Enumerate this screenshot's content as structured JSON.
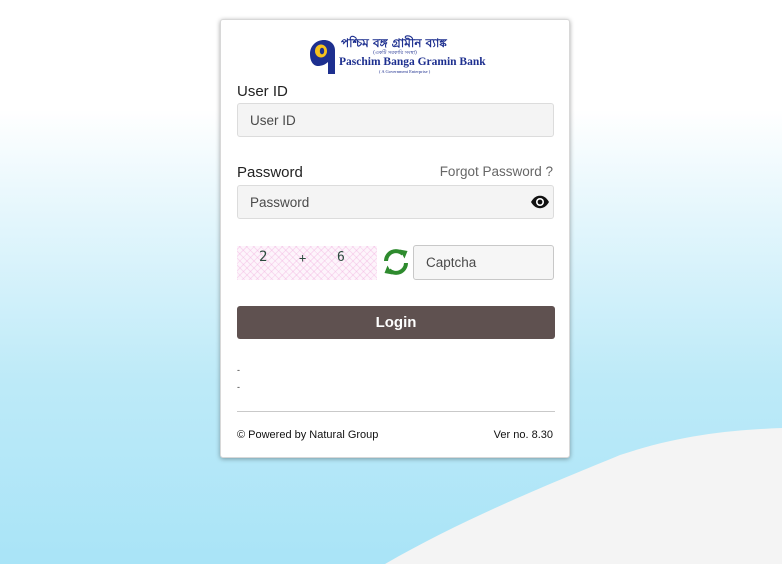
{
  "logo": {
    "bengali_name": "পশ্চিম বঙ্গ গ্রামীন ব্যাঙ্ক",
    "bengali_tagline": "(একটি সরকারি সংস্থা)",
    "english_name": "Paschim Banga Gramin Bank",
    "english_tagline": "( A Government Enterprise )"
  },
  "form": {
    "user_id_label": "User ID",
    "user_id_placeholder": "User ID",
    "password_label": "Password",
    "forgot_password": "Forgot Password ?",
    "password_placeholder": "Password",
    "captcha": {
      "a": "2",
      "op": "+",
      "b": "6"
    },
    "captcha_placeholder": "Captcha",
    "login_label": "Login",
    "messages": [
      "-",
      "-"
    ]
  },
  "footer": {
    "powered_by": "© Powered by Natural Group",
    "version": "Ver no. 8.30"
  },
  "colors": {
    "login_button": "#5f5150",
    "brand_blue": "#1d2f8f",
    "refresh_icon": "#2e8b2e"
  },
  "icons": [
    "eye-icon",
    "refresh-icon",
    "bank-logo-icon"
  ]
}
